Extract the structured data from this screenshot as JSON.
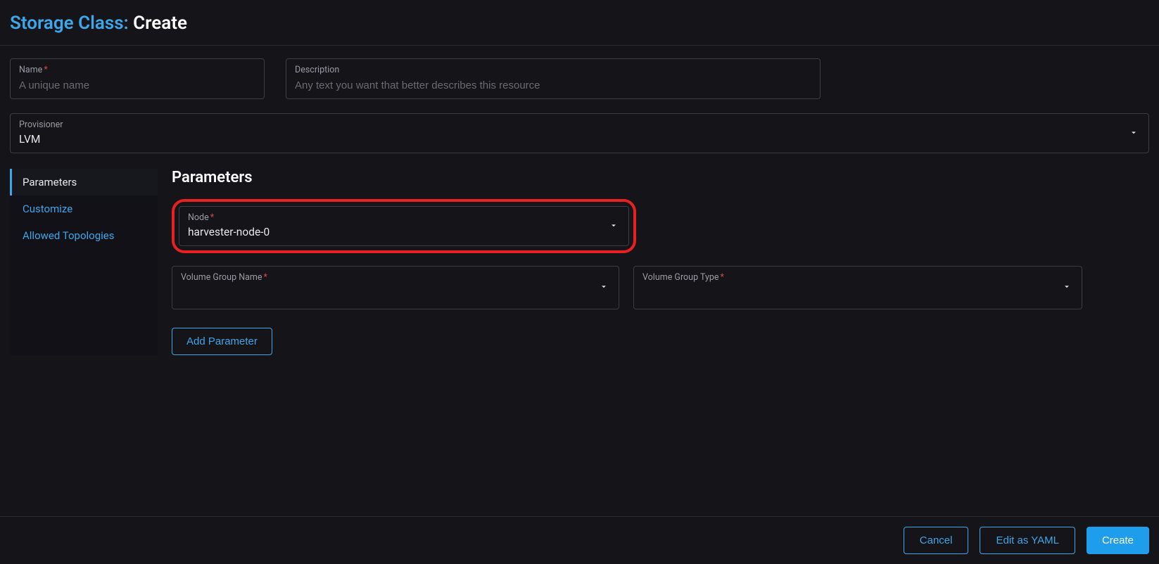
{
  "header": {
    "crumb": "Storage Class:",
    "action": "Create"
  },
  "fields": {
    "name": {
      "label": "Name",
      "required": "*",
      "placeholder": "A unique name",
      "value": ""
    },
    "description": {
      "label": "Description",
      "placeholder": "Any text you want that better describes this resource",
      "value": ""
    },
    "provisioner": {
      "label": "Provisioner",
      "value": "LVM"
    }
  },
  "tabs": {
    "parameters": "Parameters",
    "customize": "Customize",
    "allowed_topologies": "Allowed Topologies"
  },
  "panel": {
    "title": "Parameters",
    "node": {
      "label": "Node",
      "required": "*",
      "value": "harvester-node-0"
    },
    "vg_name": {
      "label": "Volume Group Name",
      "required": "*",
      "value": ""
    },
    "vg_type": {
      "label": "Volume Group Type",
      "required": "*",
      "value": ""
    },
    "add_param_btn": "Add Parameter"
  },
  "footer": {
    "cancel": "Cancel",
    "edit_yaml": "Edit as YAML",
    "create": "Create"
  }
}
